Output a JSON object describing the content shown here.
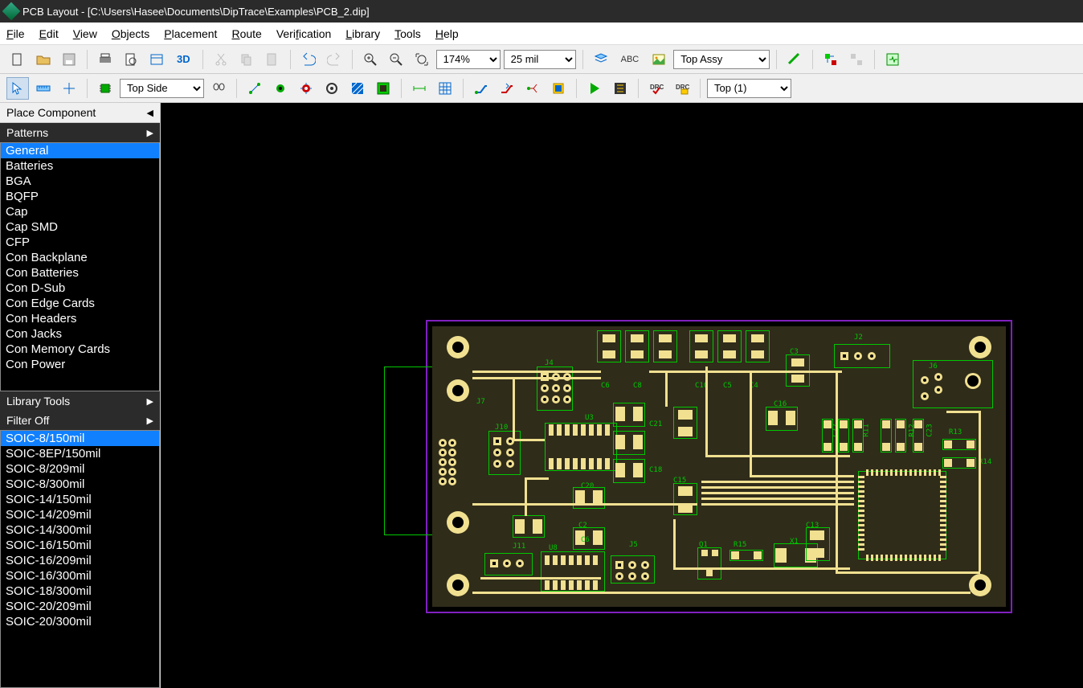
{
  "title": "PCB Layout - [C:\\Users\\Hasee\\Documents\\DipTrace\\Examples\\PCB_2.dip]",
  "menu": [
    "File",
    "Edit",
    "View",
    "Objects",
    "Placement",
    "Route",
    "Verification",
    "Library",
    "Tools",
    "Help"
  ],
  "toolbar1": {
    "btn3d": "3D",
    "zoom": "174%",
    "grid": "25 mil",
    "abc": "ABC",
    "layer_view": "Top Assy"
  },
  "toolbar2": {
    "side": "Top Side",
    "layer": "Top (1)"
  },
  "sidebar": {
    "place_component": "Place Component",
    "patterns": "Patterns",
    "library_tools": "Library Tools",
    "filter": "Filter Off",
    "categories": [
      "General",
      "Batteries",
      "BGA",
      "BQFP",
      "Cap",
      "Cap SMD",
      "CFP",
      "Con Backplane",
      "Con Batteries",
      "Con D-Sub",
      "Con Edge Cards",
      "Con Headers",
      "Con Jacks",
      "Con Memory Cards",
      "Con Power"
    ],
    "selected_category": 0,
    "patterns_list": [
      "SOIC-8/150mil",
      "SOIC-8EP/150mil",
      "SOIC-8/209mil",
      "SOIC-8/300mil",
      "SOIC-14/150mil",
      "SOIC-14/209mil",
      "SOIC-14/300mil",
      "SOIC-16/150mil",
      "SOIC-16/209mil",
      "SOIC-16/300mil",
      "SOIC-18/300mil",
      "SOIC-20/209mil",
      "SOIC-20/300mil"
    ],
    "selected_pattern": 0
  },
  "pcb": {
    "refs": [
      "J4",
      "J7",
      "J10",
      "J11",
      "U3",
      "U8",
      "C2",
      "C6",
      "C8",
      "C10",
      "C5",
      "C4",
      "C3",
      "C15",
      "C16",
      "C18",
      "C20",
      "C21",
      "C22",
      "C23",
      "C13",
      "J5",
      "J6",
      "J2",
      "R11",
      "R12",
      "R13",
      "R14",
      "R15",
      "Q1",
      "X1"
    ]
  }
}
